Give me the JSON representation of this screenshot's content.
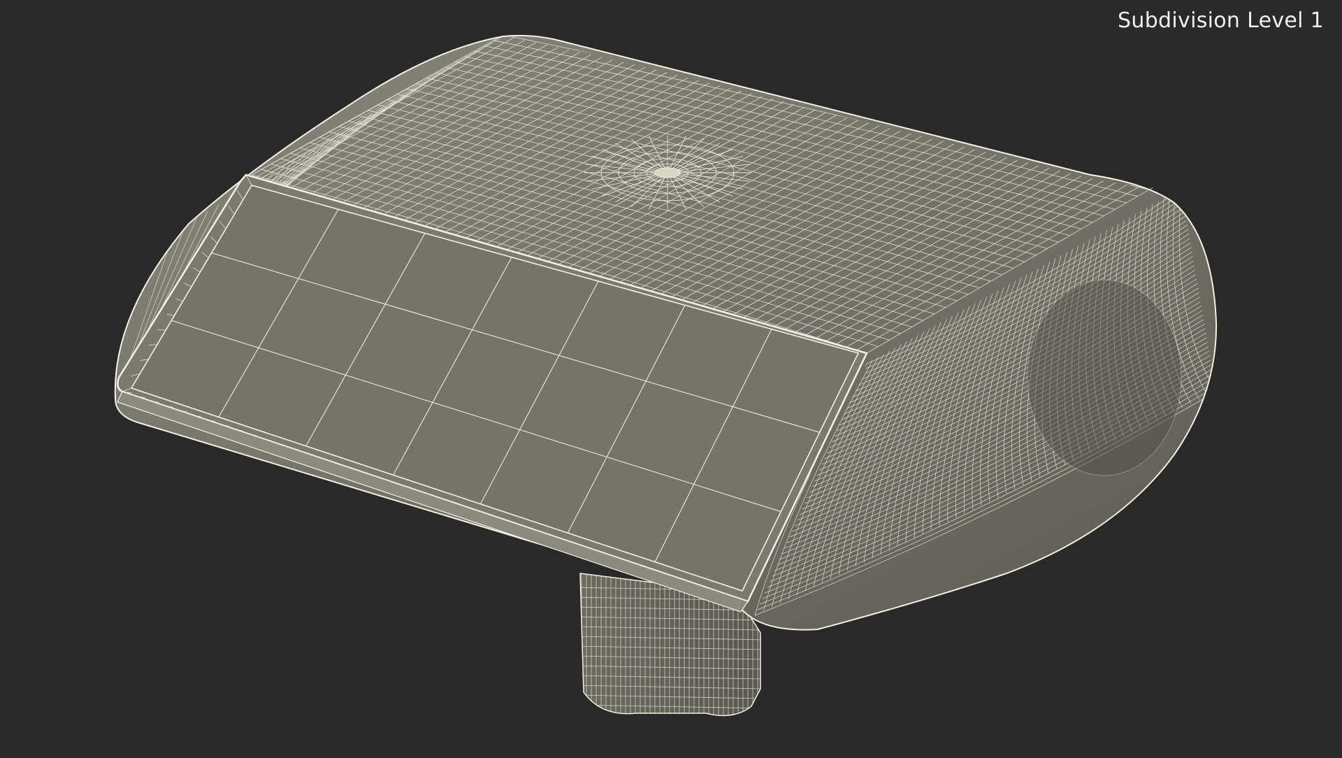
{
  "overlay": {
    "label": "Subdivision Level 1"
  },
  "viewport": {
    "background": "#292929",
    "surface_color": "#77776d",
    "wire_color": "#f4f1e2"
  }
}
